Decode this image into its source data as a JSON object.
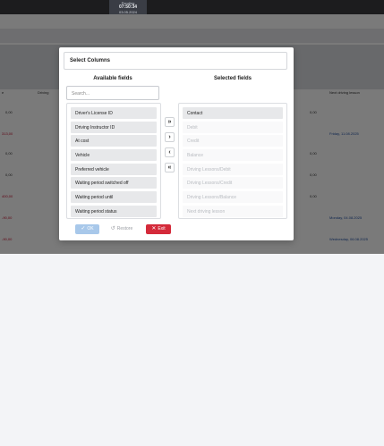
{
  "topbar": {
    "clock_label": "Pending",
    "clock_time": "07:50:34",
    "clock_date": "03.05.2024"
  },
  "background": {
    "col_headers": [
      "e",
      "Driving",
      "Next driving lesson"
    ],
    "left_values": [
      "0,00",
      "313,00",
      "0,00",
      "0,00",
      "400,00",
      "-90,00",
      "-90,00"
    ],
    "right_values": [
      "0,00",
      "0,00",
      "0,00",
      "0,00"
    ],
    "right_dates": [
      "Friday, 11.08.2025",
      "Monday, 04.08.2025",
      "Wednesday, 06.08.2025"
    ]
  },
  "modal": {
    "title": "Select Columns",
    "available_title": "Available fields",
    "selected_title": "Selected fields",
    "search_placeholder": "Search...",
    "available_fields": [
      "Driver's License ID",
      "Driving Instructor ID",
      "At cost",
      "Vehicle",
      "Preferred vehicle",
      "Waiting period switched off",
      "Waiting period until",
      "Waiting period status"
    ],
    "selected_fields": [
      "Contact",
      "Debit",
      "Credit",
      "Balance",
      "Driving Lessons/Debit",
      "Driving Lessons/Credit",
      "Driving Lessons/Balance",
      "Next driving lesson"
    ],
    "buttons": {
      "move_all_right": "»",
      "move_right": "›",
      "move_left": "‹",
      "move_all_left": "«",
      "ok": "OK",
      "restore": "Restore",
      "exit": "Exit"
    },
    "icons": {
      "ok": "check-icon",
      "restore": "undo-icon",
      "exit": "close-icon"
    }
  },
  "colors": {
    "ok_button": "#a8c8ea",
    "exit_button": "#d42a3a",
    "topbar": "#1c1c1e"
  }
}
